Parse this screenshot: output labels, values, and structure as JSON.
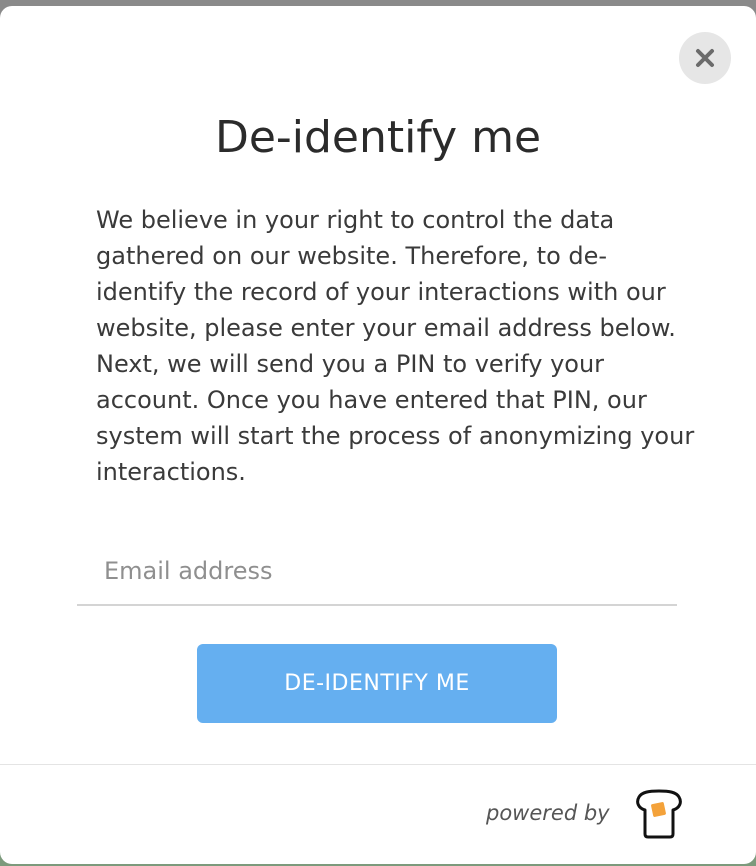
{
  "modal": {
    "title": "De-identify me",
    "description": "We believe in your right to control the data gathered on our website. Therefore, to de-identify the record of your interactions with our website, please enter your email address below. Next, we will send you a PIN to verify your account. Once you have entered that PIN, our system will start the process of anonymizing your interactions.",
    "email_input": {
      "placeholder": "Email address",
      "value": ""
    },
    "submit_label": "DE-IDENTIFY ME",
    "close_icon": "close-icon"
  },
  "footer": {
    "powered_by": "powered by",
    "logo_icon": "toast-logo-icon"
  },
  "colors": {
    "accent": "#65aff0",
    "close_bg": "#e6e6e6",
    "logo_square": "#f4a23a"
  }
}
